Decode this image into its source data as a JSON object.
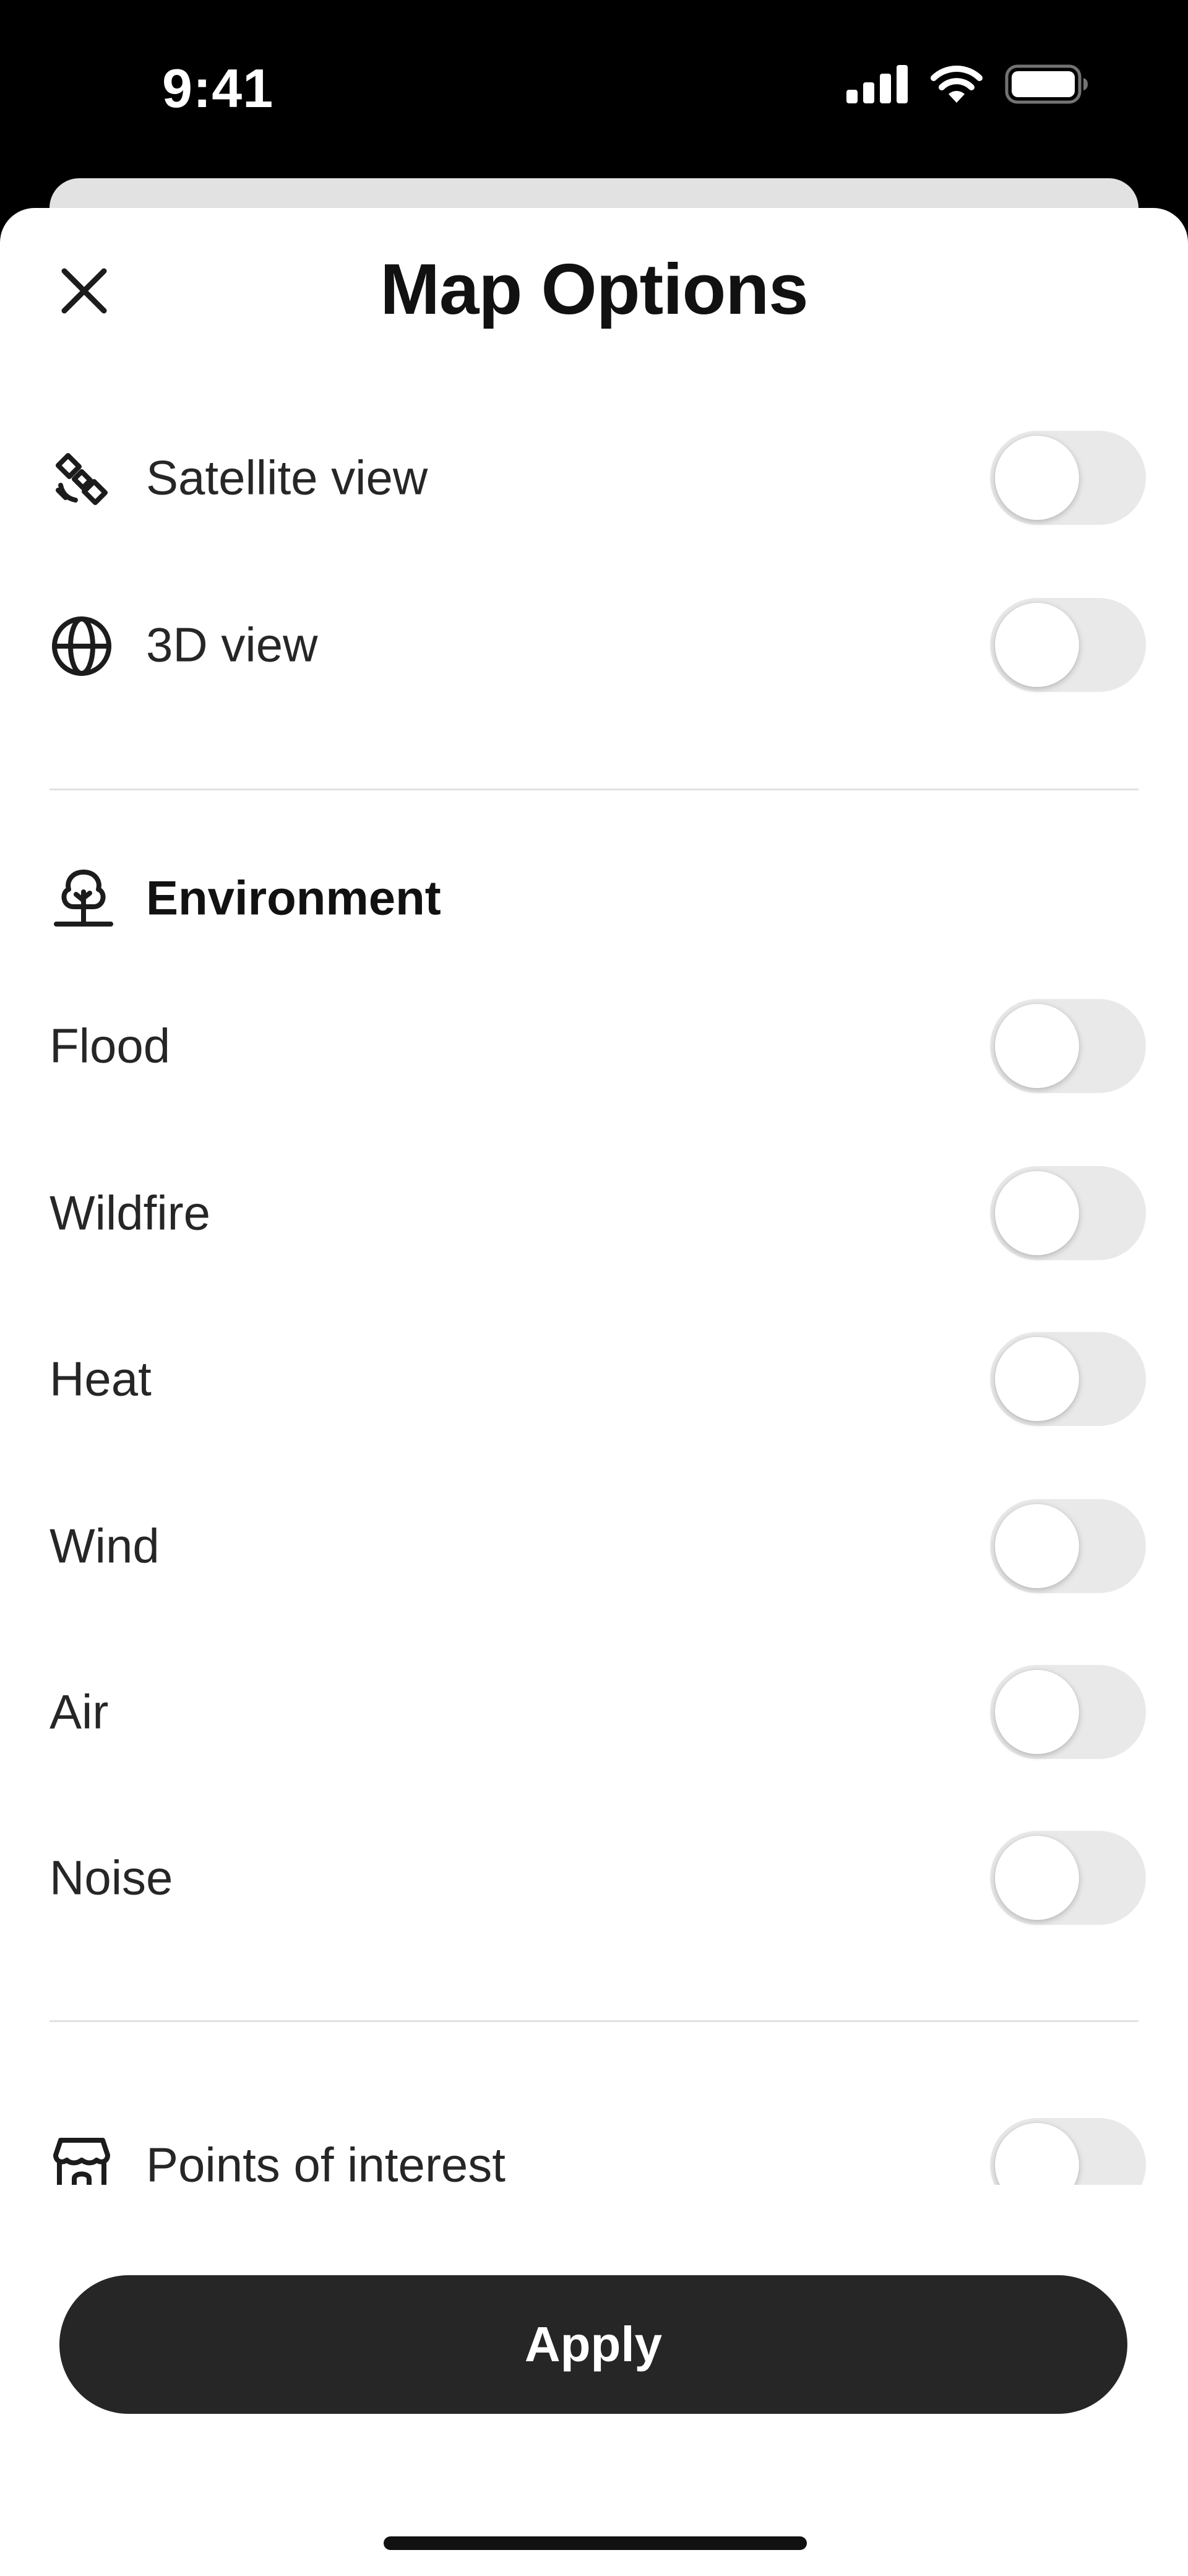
{
  "status_bar": {
    "time": "9:41",
    "icons": [
      "signal-icon",
      "wifi-icon",
      "battery-icon"
    ]
  },
  "sheet": {
    "title": "Map Options",
    "close_icon": "close-icon"
  },
  "view_options": [
    {
      "label": "Satellite view",
      "icon": "satellite-icon",
      "enabled": false
    },
    {
      "label": "3D view",
      "icon": "globe-icon",
      "enabled": false
    }
  ],
  "environment": {
    "title": "Environment",
    "icon": "tree-icon",
    "items": [
      {
        "label": "Flood",
        "enabled": false
      },
      {
        "label": "Wildfire",
        "enabled": false
      },
      {
        "label": "Heat",
        "enabled": false
      },
      {
        "label": "Wind",
        "enabled": false
      },
      {
        "label": "Air",
        "enabled": false
      },
      {
        "label": "Noise",
        "enabled": false
      }
    ]
  },
  "points_of_interest": {
    "label": "Points of interest",
    "icon": "store-icon",
    "enabled": false
  },
  "apply_label": "Apply",
  "colors": {
    "background": "#ffffff",
    "text": "#262626",
    "toggle_off": "#e9e9e9",
    "button": "#262626",
    "button_text": "#ffffff",
    "divider": "#e1e1e1"
  }
}
